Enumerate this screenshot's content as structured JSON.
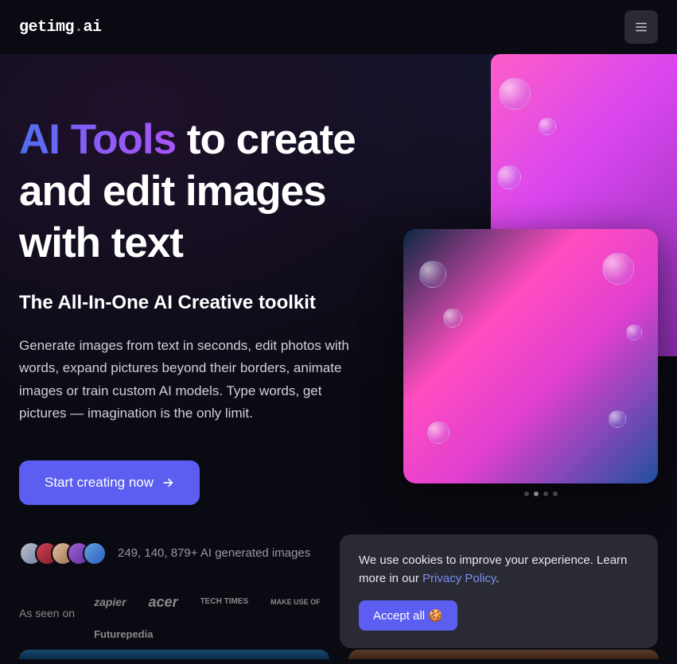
{
  "header": {
    "logo_pre": "getimg",
    "logo_dot": ".",
    "logo_suf": "ai"
  },
  "hero": {
    "title_gradient": "AI Tools",
    "title_rest": " to create and edit images with text",
    "subtitle": "The All-In-One AI Creative toolkit",
    "description": "Generate images from text in seconds, edit photos with words, expand pictures beyond their borders, animate images or train custom AI models. Type words, get pictures — imagination is the only limit.",
    "cta": "Start creating now"
  },
  "social": {
    "count_text": "249, 140, 879+ AI generated images"
  },
  "seen_on": {
    "label": "As seen on",
    "brands": [
      "zapier",
      "acer",
      "TECH TIMES",
      "MAKE USE OF",
      "Futurepedia"
    ]
  },
  "cookie": {
    "text_pre": "We use cookies to improve your experience. Learn more in our ",
    "link": "Privacy Policy",
    "text_post": ".",
    "accept": "Accept all 🍪"
  }
}
